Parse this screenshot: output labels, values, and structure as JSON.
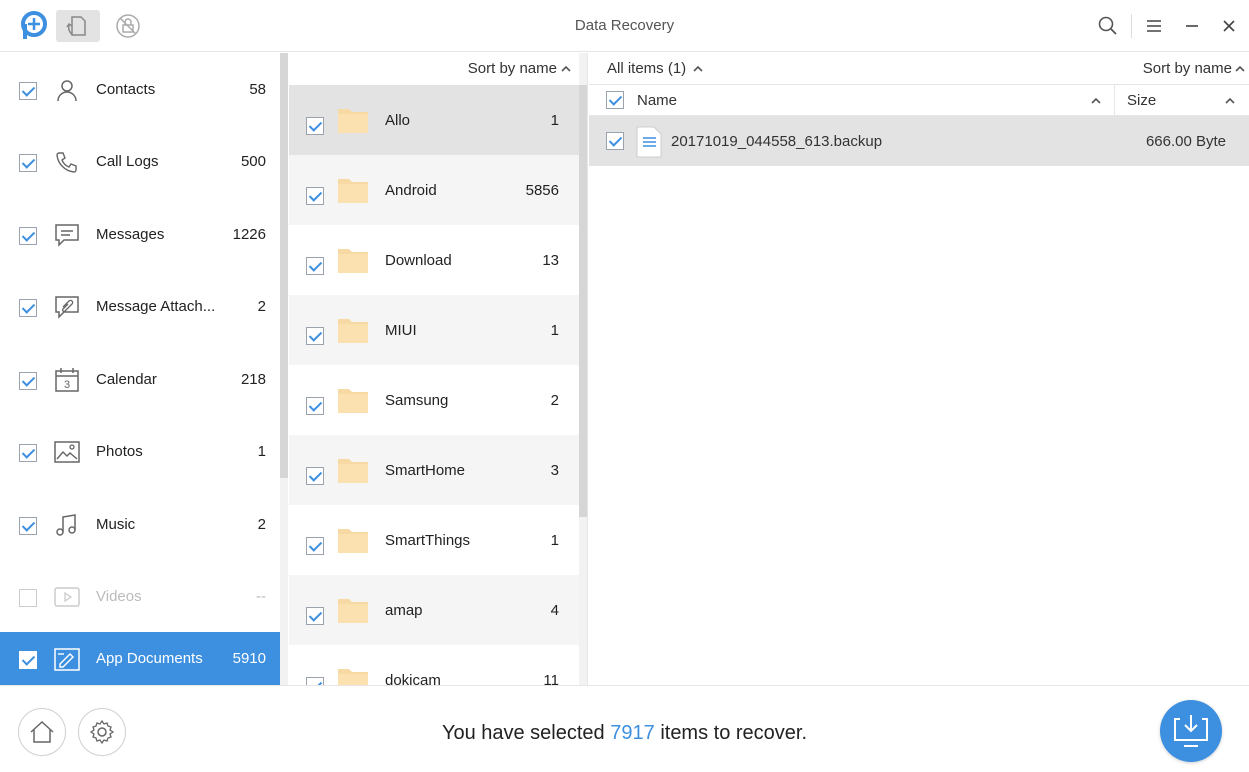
{
  "app": {
    "title": "Data Recovery",
    "accent_color": "#3d8fe0"
  },
  "titlebar": {
    "icons": [
      "app-logo-icon",
      "device-data-icon",
      "locked-device-icon"
    ],
    "actions": [
      "search-icon",
      "menu-icon",
      "minimize-icon",
      "close-icon"
    ]
  },
  "sidebar": {
    "items": [
      {
        "label": "Contacts",
        "count": "58",
        "icon": "contacts-icon",
        "checked": true
      },
      {
        "label": "Call Logs",
        "count": "500",
        "icon": "phone-icon",
        "checked": true
      },
      {
        "label": "Messages",
        "count": "1226",
        "icon": "message-icon",
        "checked": true
      },
      {
        "label": "Message Attach...",
        "count": "2",
        "icon": "attachment-icon",
        "checked": true
      },
      {
        "label": "Calendar",
        "count": "218",
        "icon": "calendar-icon",
        "checked": true
      },
      {
        "label": "Photos",
        "count": "1",
        "icon": "photo-icon",
        "checked": true
      },
      {
        "label": "Music",
        "count": "2",
        "icon": "music-icon",
        "checked": true
      },
      {
        "label": "Videos",
        "count": "--",
        "icon": "video-icon",
        "checked": false
      },
      {
        "label": "App Documents",
        "count": "5910",
        "icon": "app-documents-icon",
        "checked": true
      }
    ],
    "calendar_day": "3"
  },
  "folders": {
    "sort_label": "Sort by name",
    "items": [
      {
        "name": "Allo",
        "count": "1"
      },
      {
        "name": "Android",
        "count": "5856"
      },
      {
        "name": "Download",
        "count": "13"
      },
      {
        "name": "MIUI",
        "count": "1"
      },
      {
        "name": "Samsung",
        "count": "2"
      },
      {
        "name": "SmartHome",
        "count": "3"
      },
      {
        "name": "SmartThings",
        "count": "1"
      },
      {
        "name": "amap",
        "count": "4"
      },
      {
        "name": "dokicam",
        "count": "11"
      }
    ]
  },
  "files": {
    "filter_label": "All items (1)",
    "sort_label": "Sort by name",
    "col_name": "Name",
    "col_size": "Size",
    "rows": [
      {
        "name": "20171019_044558_613.backup",
        "size": "666.00 Byte"
      }
    ]
  },
  "footer": {
    "status_prefix": "You have selected",
    "selected_count": "7917",
    "status_suffix": "items to recover."
  }
}
